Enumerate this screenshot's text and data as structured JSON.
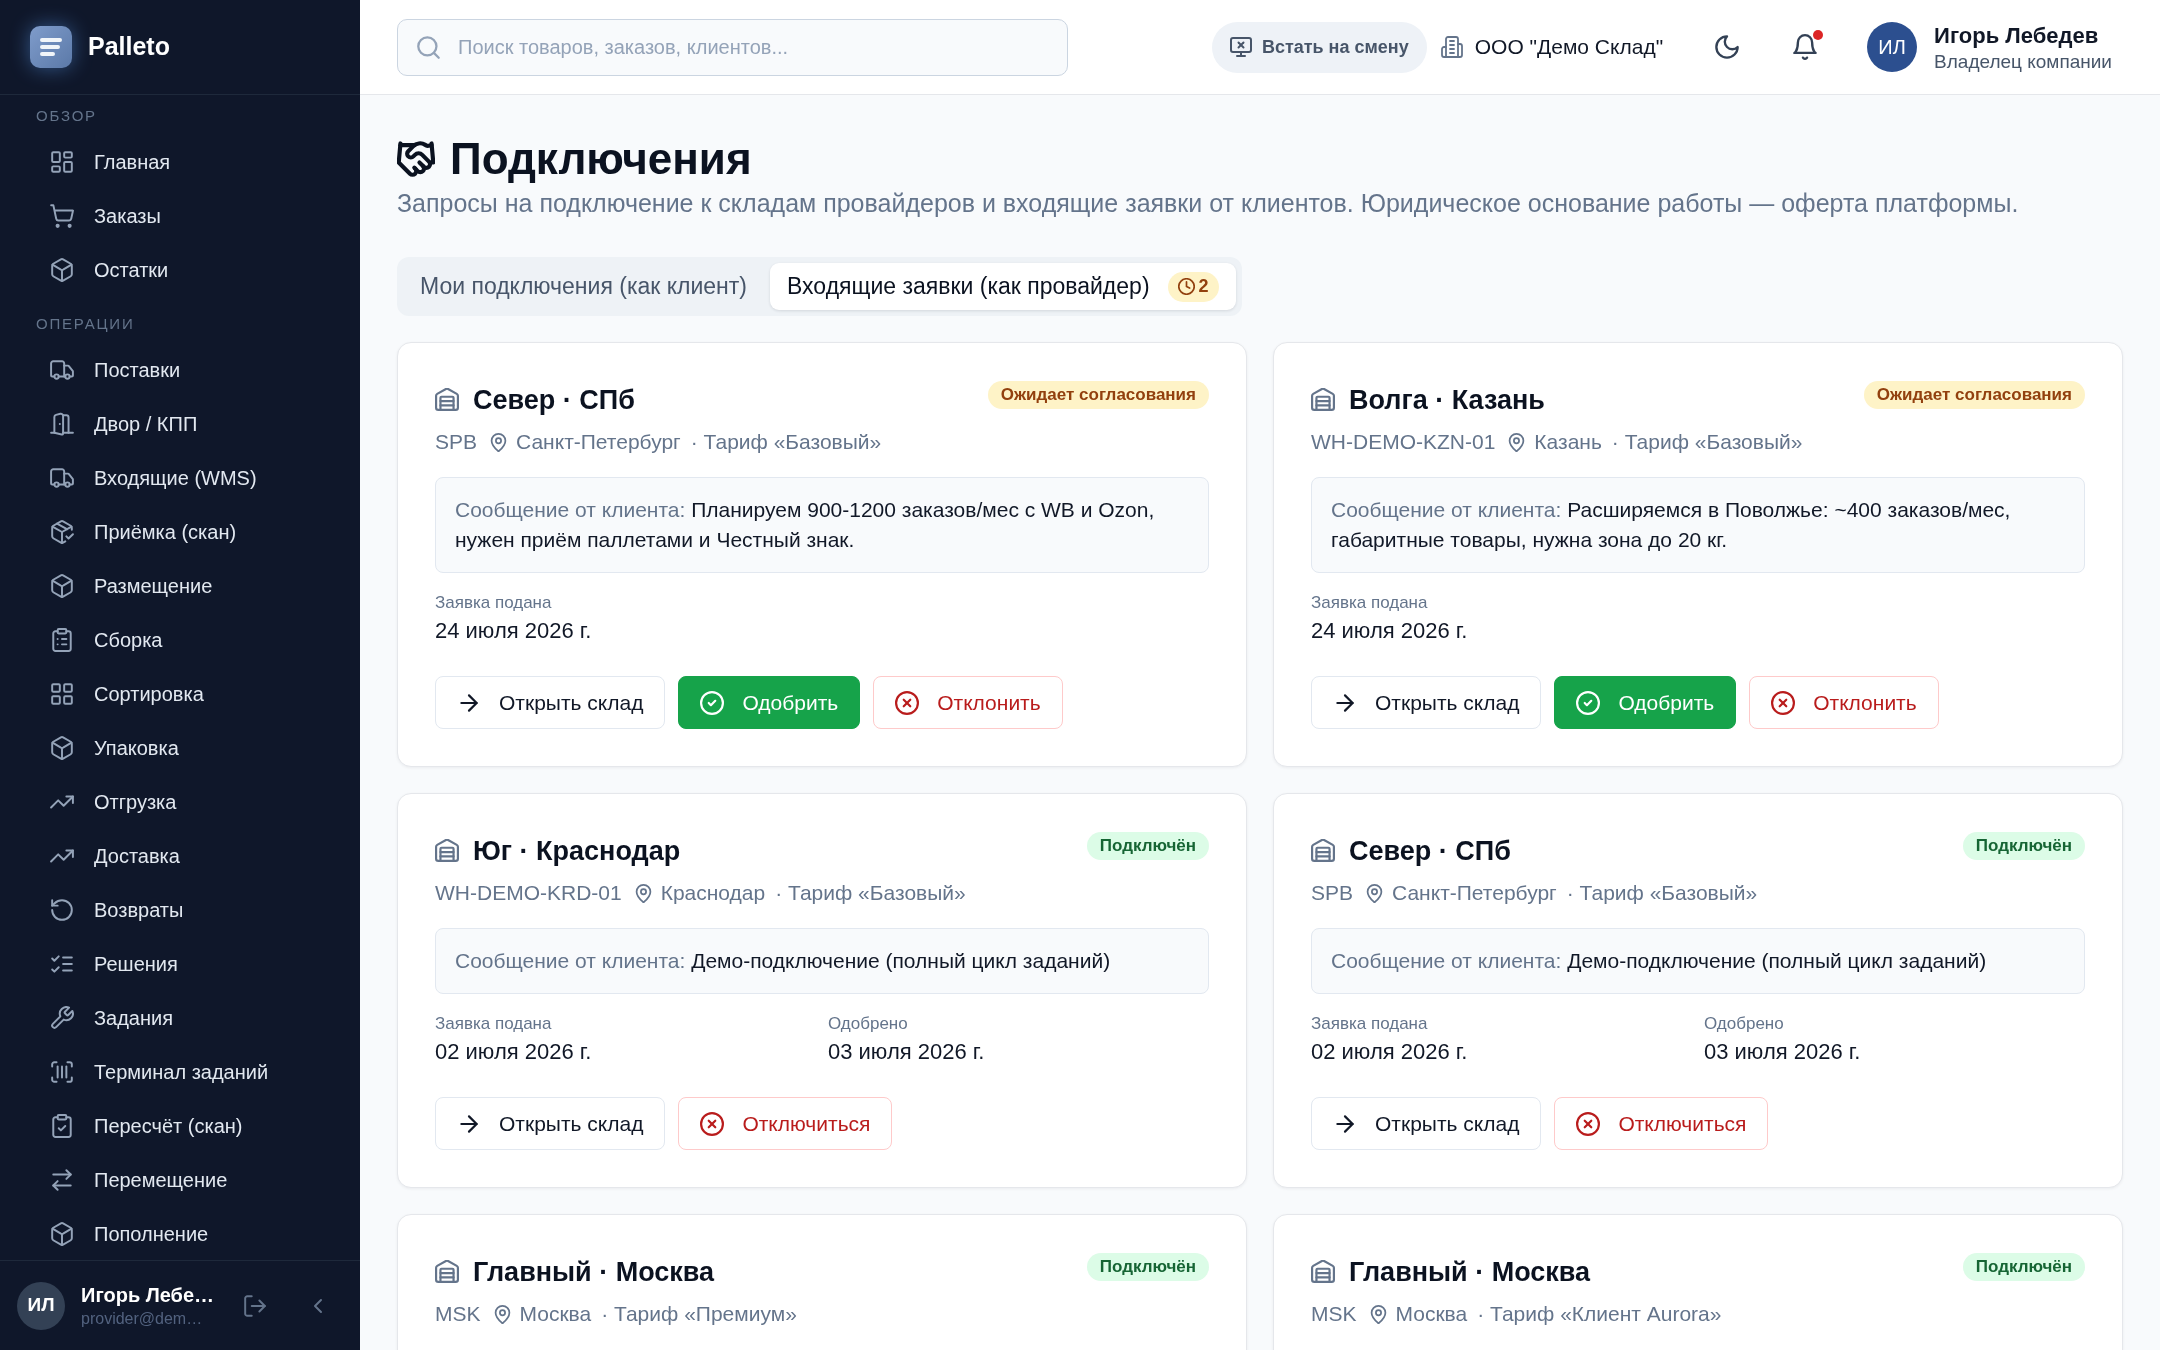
{
  "sidebar": {
    "brand": "Palleto",
    "sections": [
      {
        "title": "ОБЗОР",
        "items": [
          {
            "label": "Главная",
            "selected": false
          },
          {
            "label": "Заказы",
            "selected": false
          },
          {
            "label": "Остатки",
            "selected": false
          }
        ]
      },
      {
        "title": "ОПЕРАЦИИ",
        "items": [
          {
            "label": "Поставки",
            "selected": false
          },
          {
            "label": "Двор / КПП",
            "selected": false
          },
          {
            "label": "Входящие (WMS)",
            "selected": false
          },
          {
            "label": "Приёмка (скан)",
            "selected": false
          },
          {
            "label": "Размещение",
            "selected": false
          },
          {
            "label": "Сборка",
            "selected": false
          },
          {
            "label": "Сортировка",
            "selected": false
          },
          {
            "label": "Упаковка",
            "selected": false
          },
          {
            "label": "Отгрузка",
            "selected": false
          },
          {
            "label": "Доставка",
            "selected": false
          },
          {
            "label": "Возвраты",
            "selected": false
          },
          {
            "label": "Решения",
            "selected": false
          },
          {
            "label": "Задания",
            "selected": false
          },
          {
            "label": "Терминал заданий",
            "selected": false
          },
          {
            "label": "Пересчёт (скан)",
            "selected": false
          },
          {
            "label": "Перемещение",
            "selected": false
          },
          {
            "label": "Пополнение",
            "selected": false
          }
        ]
      }
    ],
    "user": {
      "initials": "ИЛ",
      "name": "Игорь Лебе…",
      "email": "provider@dem…"
    }
  },
  "header": {
    "search": {
      "placeholder": "Поиск товаров, заказов, клиентов..."
    },
    "shift_button": "Встать на смену",
    "company": "ООО \"Демо Склад\"",
    "notifications": {
      "unread": true
    },
    "user": {
      "initials": "ИЛ",
      "name": "Игорь Лебедев",
      "role": "Владелец компании"
    }
  },
  "page": {
    "title": "Подключения",
    "subtitle": "Запросы на подключение к складам провайдеров и входящие заявки от клиентов. Юридическое основание работы — оферта платформы.",
    "tabs": [
      {
        "label": "Мои подключения (как клиент)",
        "selected": false
      },
      {
        "label": "Входящие заявки (как провайдер)",
        "selected": true,
        "badge": "2"
      }
    ]
  },
  "cards": [
    {
      "title": "Север · СПб",
      "status": {
        "label": "Ожидает согласования",
        "kind": "pending"
      },
      "code": "SPB",
      "city": "Санкт-Петербург",
      "tariff": "· Тариф «Базовый»",
      "message": {
        "label": "Сообщение от клиента:",
        "text": "Планируем 900-1200 заказов/мес с WB и Ozon, нужен приём паллетами и Честный знак."
      },
      "dates": [
        {
          "label": "Заявка подана",
          "value": "24 июля 2026 г."
        }
      ],
      "actions": [
        {
          "label": "Открыть склад",
          "kind": "open"
        },
        {
          "label": "Одобрить",
          "kind": "approve"
        },
        {
          "label": "Отклонить",
          "kind": "reject"
        }
      ]
    },
    {
      "title": "Волга · Казань",
      "status": {
        "label": "Ожидает согласования",
        "kind": "pending"
      },
      "code": "WH-DEMO-KZN-01",
      "city": "Казань",
      "tariff": "· Тариф «Базовый»",
      "message": {
        "label": "Сообщение от клиента:",
        "text": "Расширяемся в Поволжье: ~400 заказов/мес, габаритные товары, нужна зона до 20 кг."
      },
      "dates": [
        {
          "label": "Заявка подана",
          "value": "24 июля 2026 г."
        }
      ],
      "actions": [
        {
          "label": "Открыть склад",
          "kind": "open"
        },
        {
          "label": "Одобрить",
          "kind": "approve"
        },
        {
          "label": "Отклонить",
          "kind": "reject"
        }
      ]
    },
    {
      "title": "Юг · Краснодар",
      "status": {
        "label": "Подключён",
        "kind": "connected"
      },
      "code": "WH-DEMO-KRD-01",
      "city": "Краснодар",
      "tariff": "· Тариф «Базовый»",
      "message": {
        "label": "Сообщение от клиента:",
        "text": "Демо-подключение (полный цикл заданий)"
      },
      "dates": [
        {
          "label": "Заявка подана",
          "value": "02 июля 2026 г."
        },
        {
          "label": "Одобрено",
          "value": "03 июля 2026 г."
        }
      ],
      "actions": [
        {
          "label": "Открыть склад",
          "kind": "open"
        },
        {
          "label": "Отключиться",
          "kind": "disconnect"
        }
      ]
    },
    {
      "title": "Север · СПб",
      "status": {
        "label": "Подключён",
        "kind": "connected"
      },
      "code": "SPB",
      "city": "Санкт-Петербург",
      "tariff": "· Тариф «Базовый»",
      "message": {
        "label": "Сообщение от клиента:",
        "text": "Демо-подключение (полный цикл заданий)"
      },
      "dates": [
        {
          "label": "Заявка подана",
          "value": "02 июля 2026 г."
        },
        {
          "label": "Одобрено",
          "value": "03 июля 2026 г."
        }
      ],
      "actions": [
        {
          "label": "Открыть склад",
          "kind": "open"
        },
        {
          "label": "Отключиться",
          "kind": "disconnect"
        }
      ]
    },
    {
      "title": "Главный · Москва",
      "status": {
        "label": "Подключён",
        "kind": "connected"
      },
      "code": "MSK",
      "city": "Москва",
      "tariff": "· Тариф «Премиум»"
    },
    {
      "title": "Главный · Москва",
      "status": {
        "label": "Подключён",
        "kind": "connected"
      },
      "code": "MSK",
      "city": "Москва",
      "tariff": "· Тариф «Клиент Aurora»"
    }
  ]
}
